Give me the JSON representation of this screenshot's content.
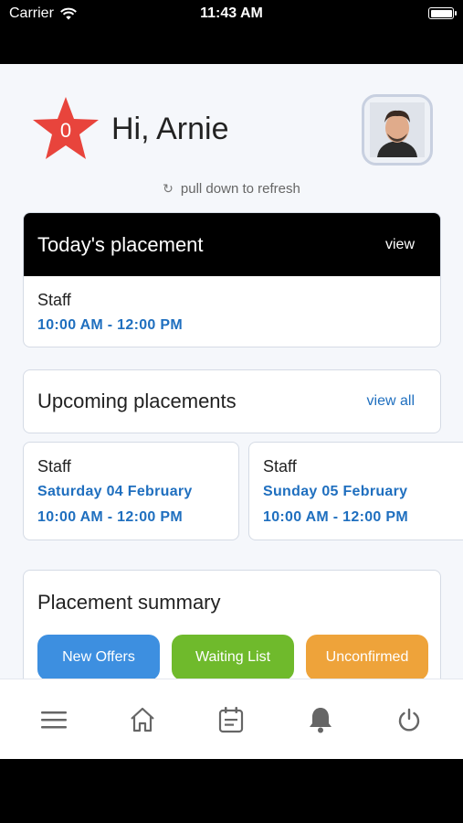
{
  "status_bar": {
    "carrier": "Carrier",
    "time": "11:43 AM"
  },
  "header": {
    "badge_count": "0",
    "greeting": "Hi, Arnie"
  },
  "refresh": {
    "label": "pull down to refresh"
  },
  "today": {
    "title": "Today's placement",
    "view_label": "view",
    "role": "Staff",
    "time": "10:00 AM - 12:00 PM"
  },
  "upcoming": {
    "title": "Upcoming placements",
    "view_all_label": "view all",
    "items": [
      {
        "role": "Staff",
        "date": "Saturday 04 February",
        "time": "10:00 AM - 12:00 PM"
      },
      {
        "role": "Staff",
        "date": "Sunday 05 February",
        "time": "10:00 AM - 12:00 PM"
      }
    ]
  },
  "summary": {
    "title": "Placement summary",
    "buttons": [
      {
        "label": "New Offers",
        "color": "#3d8fe0"
      },
      {
        "label": "Waiting List",
        "color": "#6fba2c"
      },
      {
        "label": "Unconfirmed",
        "color": "#eea33a"
      }
    ]
  },
  "tabbar": {
    "icons": [
      "menu-icon",
      "home-icon",
      "calendar-icon",
      "bell-icon",
      "power-icon"
    ]
  },
  "colors": {
    "accent_blue": "#1f6fbf",
    "badge_red": "#e8443c"
  }
}
